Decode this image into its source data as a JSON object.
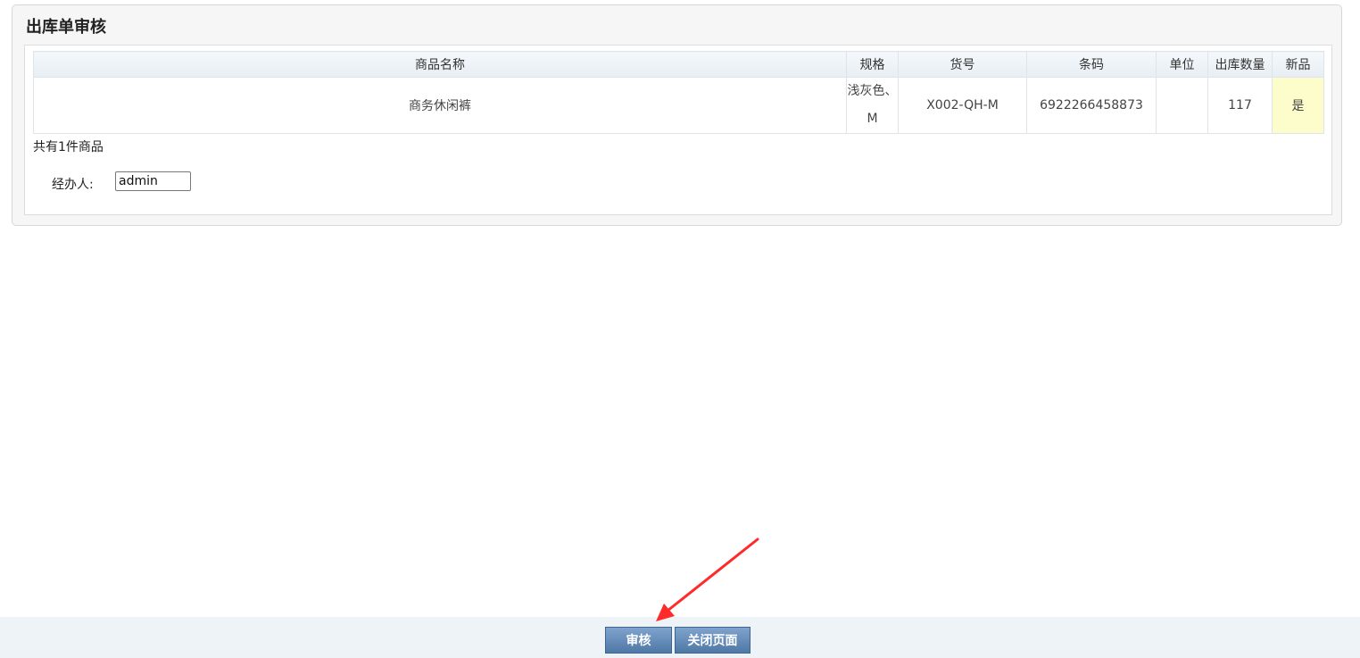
{
  "panel": {
    "title": "出库单审核"
  },
  "table": {
    "headers": [
      "商品名称",
      "规格",
      "货号",
      "条码",
      "单位",
      "出库数量",
      "新品"
    ],
    "rows": [
      {
        "name": "商务休闲裤",
        "spec": "浅灰色、M",
        "sku": "X002-QH-M",
        "barcode": "6922266458873",
        "unit": "",
        "quantity": "117",
        "is_new": "是"
      }
    ]
  },
  "summary": {
    "total_text": "共有1件商品"
  },
  "handler": {
    "label": "经办人:",
    "value": "admin"
  },
  "actions": {
    "audit_label": "审核",
    "close_label": "关闭页面"
  },
  "colors": {
    "button": "#5b82b0",
    "new_highlight": "#fdfdcb",
    "new_text": "#c00000",
    "annotation_arrow": "#ff2a2a"
  }
}
